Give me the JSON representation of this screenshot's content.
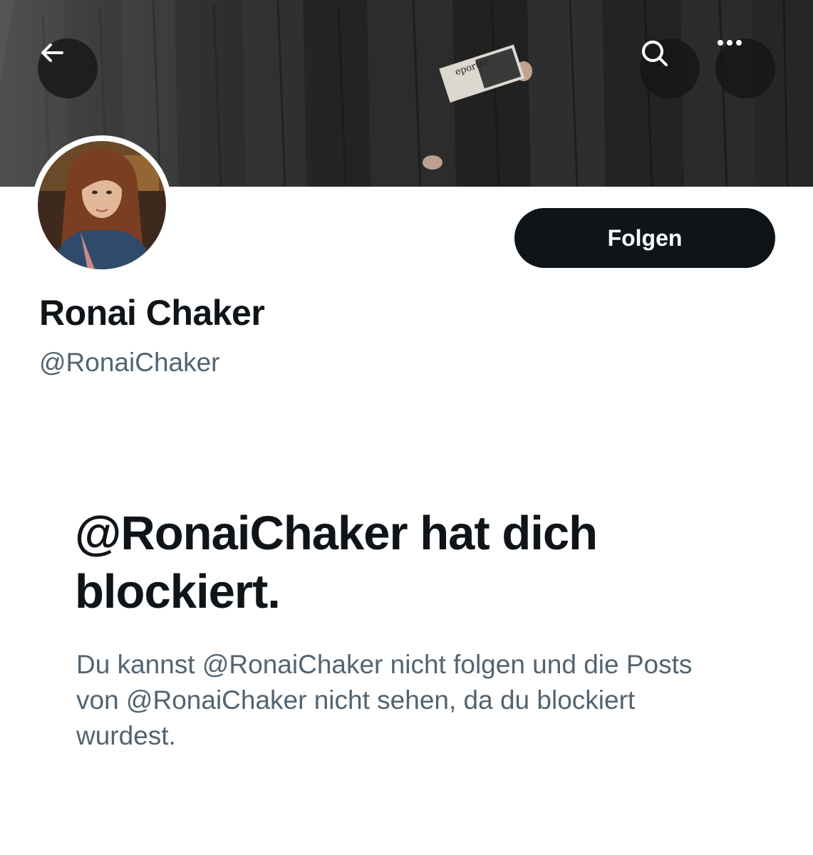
{
  "profile": {
    "display_name": "Ronai Chaker",
    "handle": "@RonaiChaker",
    "follow_label": "Folgen"
  },
  "banner": {
    "magazine_text": "eporter"
  },
  "blocked": {
    "title": "@RonaiChaker hat dich blockiert.",
    "description": "Du kannst @RonaiChaker nicht folgen und die Posts von @RonaiChaker nicht sehen, da du blockiert wurdest."
  },
  "icons": {
    "back": "arrow-left-icon",
    "search": "search-icon",
    "more": "more-horizontal-icon"
  },
  "colors": {
    "text_primary": "#0f1419",
    "text_secondary": "#536471",
    "button_bg": "#0f1419",
    "button_text": "#ffffff"
  }
}
